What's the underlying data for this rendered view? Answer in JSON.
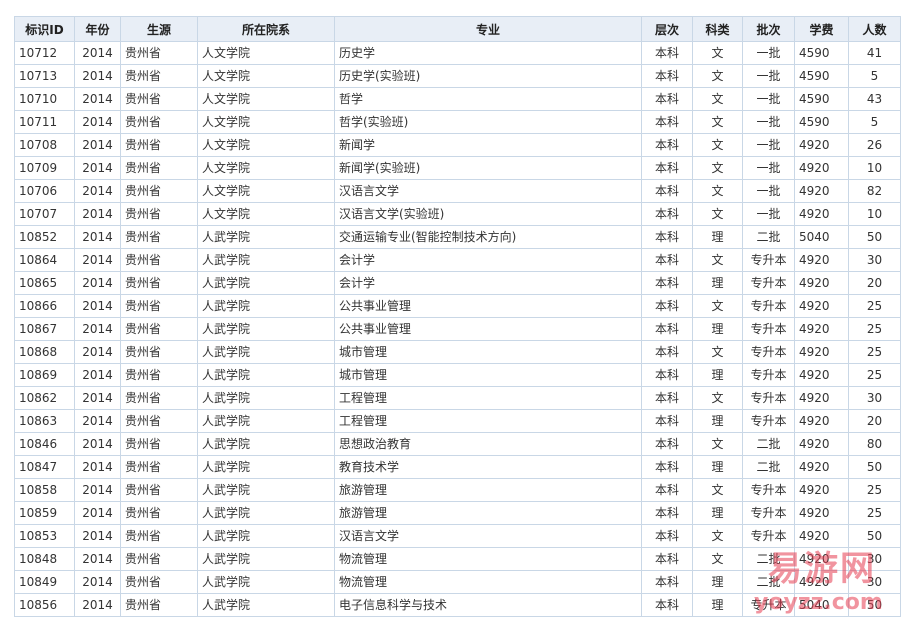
{
  "headers": [
    "标识ID",
    "年份",
    "生源",
    "所在院系",
    "专业",
    "层次",
    "科类",
    "批次",
    "学费",
    "人数"
  ],
  "rows": [
    [
      "10712",
      "2014",
      "贵州省",
      "人文学院",
      "历史学",
      "本科",
      "文",
      "一批",
      "4590",
      "41"
    ],
    [
      "10713",
      "2014",
      "贵州省",
      "人文学院",
      "历史学(实验班)",
      "本科",
      "文",
      "一批",
      "4590",
      "5"
    ],
    [
      "10710",
      "2014",
      "贵州省",
      "人文学院",
      "哲学",
      "本科",
      "文",
      "一批",
      "4590",
      "43"
    ],
    [
      "10711",
      "2014",
      "贵州省",
      "人文学院",
      "哲学(实验班)",
      "本科",
      "文",
      "一批",
      "4590",
      "5"
    ],
    [
      "10708",
      "2014",
      "贵州省",
      "人文学院",
      "新闻学",
      "本科",
      "文",
      "一批",
      "4920",
      "26"
    ],
    [
      "10709",
      "2014",
      "贵州省",
      "人文学院",
      "新闻学(实验班)",
      "本科",
      "文",
      "一批",
      "4920",
      "10"
    ],
    [
      "10706",
      "2014",
      "贵州省",
      "人文学院",
      "汉语言文学",
      "本科",
      "文",
      "一批",
      "4920",
      "82"
    ],
    [
      "10707",
      "2014",
      "贵州省",
      "人文学院",
      "汉语言文学(实验班)",
      "本科",
      "文",
      "一批",
      "4920",
      "10"
    ],
    [
      "10852",
      "2014",
      "贵州省",
      "人武学院",
      "交通运输专业(智能控制技术方向)",
      "本科",
      "理",
      "二批",
      "5040",
      "50"
    ],
    [
      "10864",
      "2014",
      "贵州省",
      "人武学院",
      "会计学",
      "本科",
      "文",
      "专升本",
      "4920",
      "30"
    ],
    [
      "10865",
      "2014",
      "贵州省",
      "人武学院",
      "会计学",
      "本科",
      "理",
      "专升本",
      "4920",
      "20"
    ],
    [
      "10866",
      "2014",
      "贵州省",
      "人武学院",
      "公共事业管理",
      "本科",
      "文",
      "专升本",
      "4920",
      "25"
    ],
    [
      "10867",
      "2014",
      "贵州省",
      "人武学院",
      "公共事业管理",
      "本科",
      "理",
      "专升本",
      "4920",
      "25"
    ],
    [
      "10868",
      "2014",
      "贵州省",
      "人武学院",
      "城市管理",
      "本科",
      "文",
      "专升本",
      "4920",
      "25"
    ],
    [
      "10869",
      "2014",
      "贵州省",
      "人武学院",
      "城市管理",
      "本科",
      "理",
      "专升本",
      "4920",
      "25"
    ],
    [
      "10862",
      "2014",
      "贵州省",
      "人武学院",
      "工程管理",
      "本科",
      "文",
      "专升本",
      "4920",
      "30"
    ],
    [
      "10863",
      "2014",
      "贵州省",
      "人武学院",
      "工程管理",
      "本科",
      "理",
      "专升本",
      "4920",
      "20"
    ],
    [
      "10846",
      "2014",
      "贵州省",
      "人武学院",
      "思想政治教育",
      "本科",
      "文",
      "二批",
      "4920",
      "80"
    ],
    [
      "10847",
      "2014",
      "贵州省",
      "人武学院",
      "教育技术学",
      "本科",
      "理",
      "二批",
      "4920",
      "50"
    ],
    [
      "10858",
      "2014",
      "贵州省",
      "人武学院",
      "旅游管理",
      "本科",
      "文",
      "专升本",
      "4920",
      "25"
    ],
    [
      "10859",
      "2014",
      "贵州省",
      "人武学院",
      "旅游管理",
      "本科",
      "理",
      "专升本",
      "4920",
      "25"
    ],
    [
      "10853",
      "2014",
      "贵州省",
      "人武学院",
      "汉语言文学",
      "本科",
      "文",
      "专升本",
      "4920",
      "50"
    ],
    [
      "10848",
      "2014",
      "贵州省",
      "人武学院",
      "物流管理",
      "本科",
      "文",
      "二批",
      "4920",
      "30"
    ],
    [
      "10849",
      "2014",
      "贵州省",
      "人武学院",
      "物流管理",
      "本科",
      "理",
      "二批",
      "4920",
      "30"
    ],
    [
      "10856",
      "2014",
      "贵州省",
      "人武学院",
      "电子信息科学与技术",
      "本科",
      "理",
      "专升本",
      "5040",
      "50"
    ]
  ],
  "watermark": {
    "top": "易游网",
    "bottom": "yoyzz.com"
  }
}
